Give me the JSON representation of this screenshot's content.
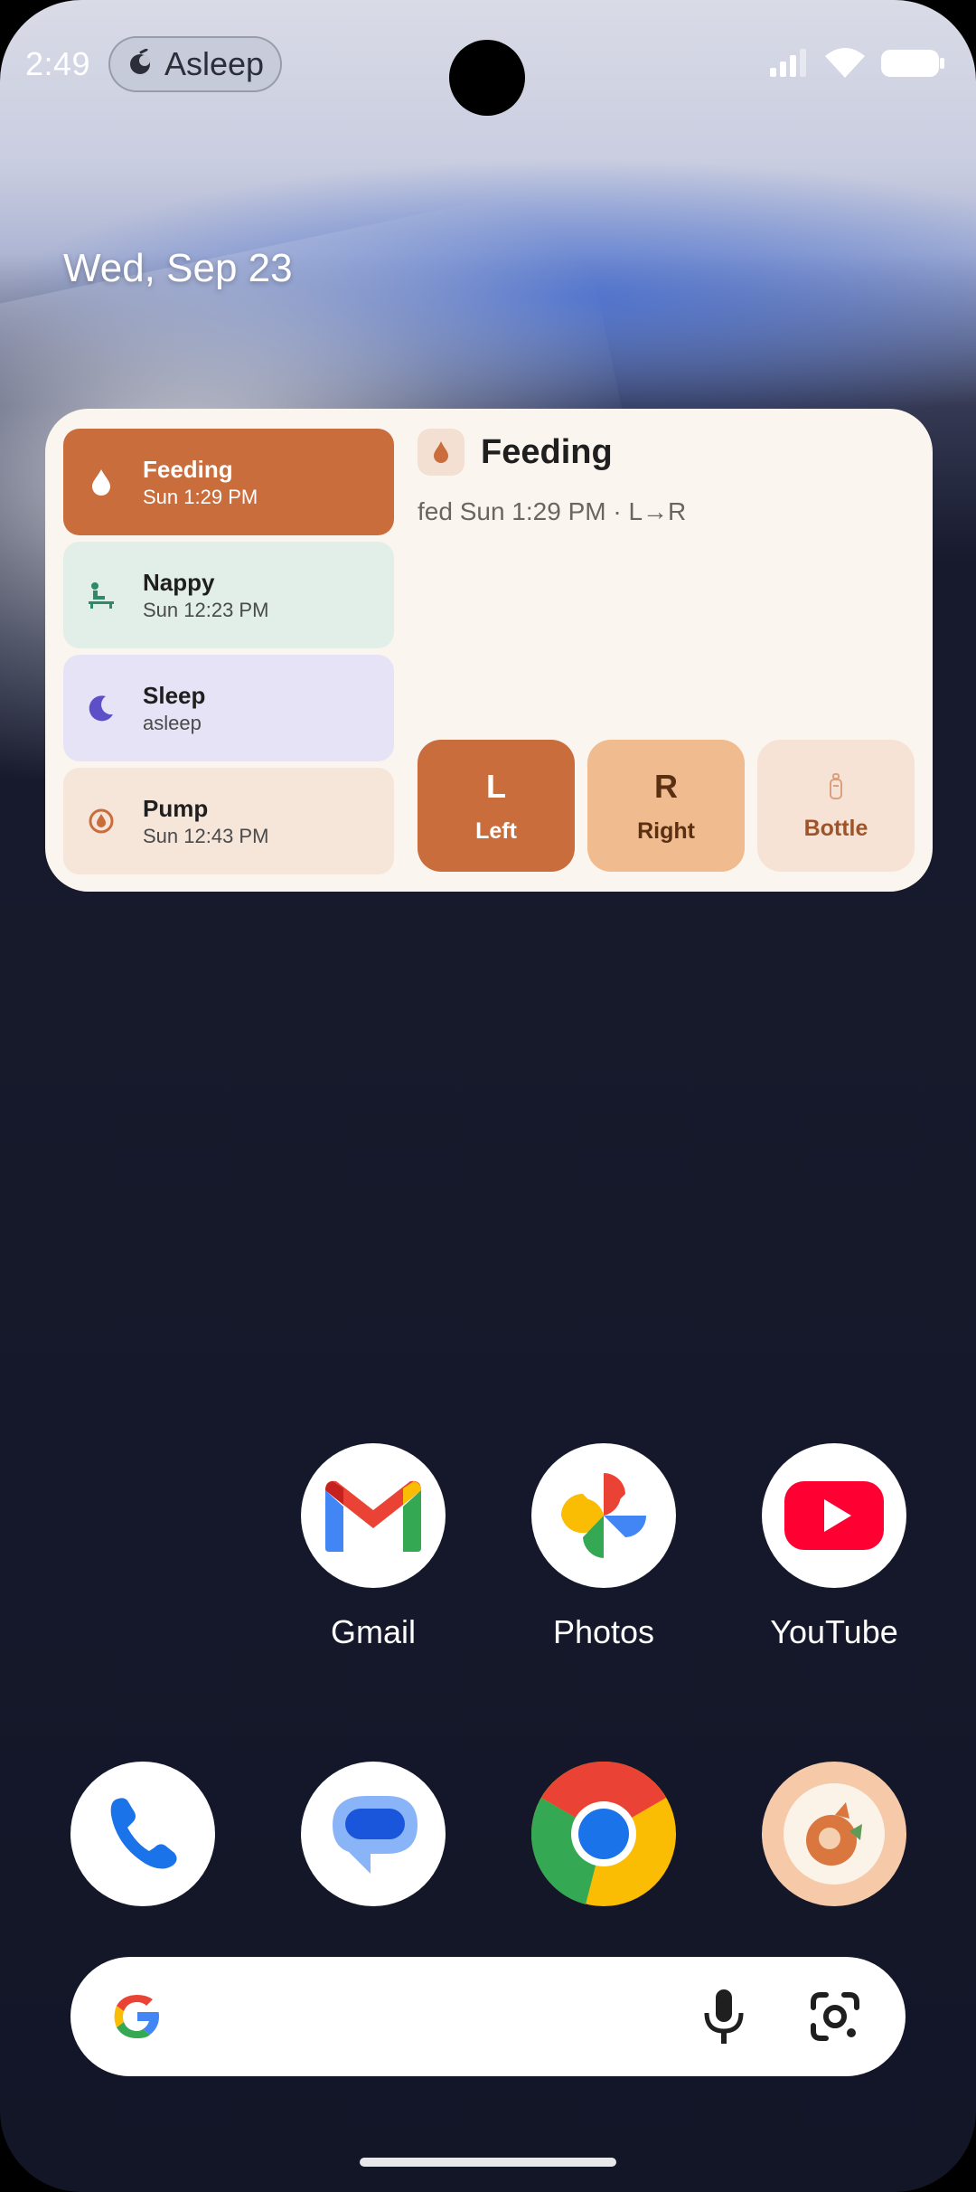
{
  "status_bar": {
    "time": "2:49",
    "pill_label": "Asleep",
    "icons": [
      "signal-icon",
      "wifi-icon",
      "battery-icon"
    ]
  },
  "home": {
    "date": "Wed, Sep 23"
  },
  "widget": {
    "items": [
      {
        "title": "Feeding",
        "subtitle": "Sun 1:29 PM",
        "icon": "drop-icon"
      },
      {
        "title": "Nappy",
        "subtitle": "Sun 12:23 PM",
        "icon": "changing-table-icon"
      },
      {
        "title": "Sleep",
        "subtitle": "asleep",
        "icon": "moon-icon"
      },
      {
        "title": "Pump",
        "subtitle": "Sun 12:43 PM",
        "icon": "pump-icon"
      }
    ],
    "detail": {
      "title": "Feeding",
      "subtitle": "fed Sun 1:29 PM · L→R"
    },
    "buttons": [
      {
        "big": "L",
        "label": "Left"
      },
      {
        "big": "R",
        "label": "Right"
      },
      {
        "label": "Bottle",
        "icon": "bottle-icon"
      }
    ],
    "colors": {
      "accent": "#c96d3d",
      "background": "#fbf5ef"
    }
  },
  "apps_row": [
    {
      "label": "Gmail",
      "icon": "gmail-icon"
    },
    {
      "label": "Photos",
      "icon": "photos-icon"
    },
    {
      "label": "YouTube",
      "icon": "youtube-icon"
    }
  ],
  "dock": [
    {
      "icon": "phone-icon"
    },
    {
      "icon": "messages-icon"
    },
    {
      "icon": "chrome-icon"
    },
    {
      "icon": "baby-tracker-app-icon"
    }
  ],
  "search_bar": {
    "icons": [
      "google-g-icon",
      "microphone-icon",
      "google-lens-icon"
    ]
  }
}
